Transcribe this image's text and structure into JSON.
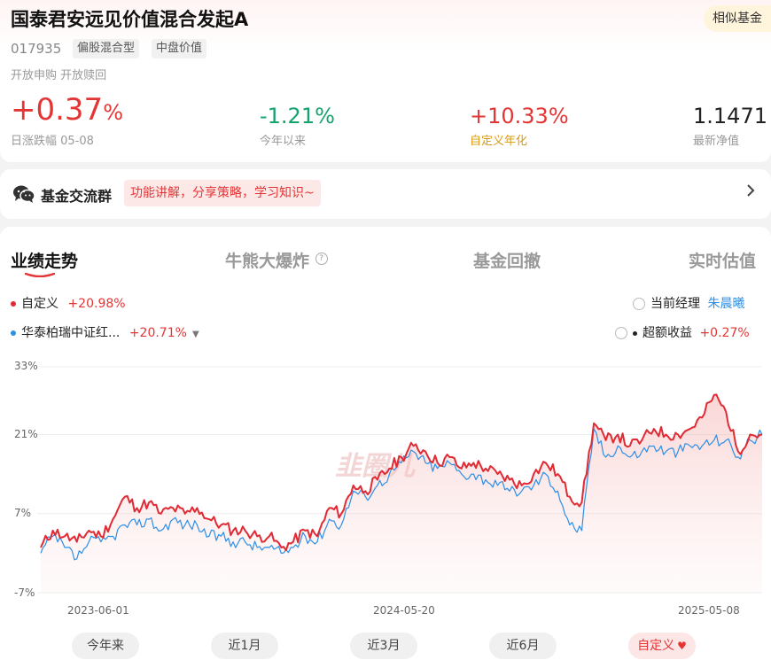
{
  "fund": {
    "name": "国泰君安远见价值混合发起A",
    "similar_label": "相似基金",
    "code": "017935",
    "tags": [
      "偏股混合型",
      "中盘价值"
    ],
    "status": "开放申购  开放赎回"
  },
  "stats": {
    "daily": {
      "value": "+0.37",
      "unit": "%",
      "label": "日涨跌幅 05-08"
    },
    "ytd": {
      "value": "-1.21%",
      "label": "今年以来"
    },
    "custom": {
      "value": "+10.33%",
      "label": "自定义年化"
    },
    "nav": {
      "value": "1.1471",
      "label": "最新净值"
    }
  },
  "group": {
    "title": "基金交流群",
    "tagline": "功能讲解，分享策略，学习知识~"
  },
  "perf": {
    "tabs": [
      "业绩走势",
      "牛熊大爆炸",
      "基金回撤",
      "实时估值"
    ],
    "legend": {
      "fund_name": "自定义",
      "fund_value": "+20.98%",
      "bench_name": "华泰柏瑞中证红...",
      "bench_value": "+20.71%",
      "manager_label": "当前经理",
      "manager_name": "朱晨曦",
      "excess_label": "超额收益",
      "excess_value": "+0.27%"
    },
    "ranges": [
      "今年来",
      "近1月",
      "近3月",
      "近6月",
      "自定义"
    ]
  },
  "colors": {
    "fund": "#e02a34",
    "bench": "#2d8fe6",
    "red": "#e43535",
    "green": "#15a26d",
    "gold": "#d99b14"
  },
  "icons": {
    "wechat": "wechat-icon",
    "help": "help-icon",
    "heart": "heart-icon",
    "chevron": "chevron-right-icon"
  },
  "chart_data": {
    "type": "line",
    "x_ticks": [
      "2023-06-01",
      "2024-05-20",
      "2025-05-08"
    ],
    "y_ticks": [
      "33%",
      "21%",
      "7%",
      "-7%"
    ],
    "ylim": [
      -7,
      33
    ],
    "series": [
      {
        "name": "自定义",
        "values": [
          1,
          4,
          3,
          2,
          4,
          3,
          6,
          10,
          8,
          9,
          7,
          8,
          7,
          8,
          6,
          5,
          4,
          4,
          3,
          3,
          1,
          2,
          4,
          3,
          8,
          7,
          12,
          11,
          13,
          15,
          17,
          19,
          18,
          16,
          17,
          15,
          16,
          15,
          14,
          13,
          12,
          14,
          16,
          14,
          10,
          9,
          23,
          20,
          21,
          19,
          20,
          22,
          21,
          21,
          22,
          24,
          28,
          25,
          18,
          21,
          21
        ]
      },
      {
        "name": "华泰柏瑞中证红...",
        "values": [
          0,
          3,
          1,
          -1,
          2,
          2,
          3,
          5,
          5,
          6,
          4,
          6,
          5,
          5,
          3,
          3,
          2,
          2,
          1,
          1,
          0,
          1,
          3,
          2,
          6,
          5,
          11,
          10,
          12,
          14,
          16,
          18,
          16,
          15,
          16,
          14,
          14,
          13,
          12,
          11,
          11,
          12,
          14,
          11,
          5,
          4,
          22,
          17,
          19,
          17,
          18,
          19,
          18,
          18,
          19,
          19,
          20,
          20,
          17,
          20,
          21
        ]
      }
    ]
  }
}
